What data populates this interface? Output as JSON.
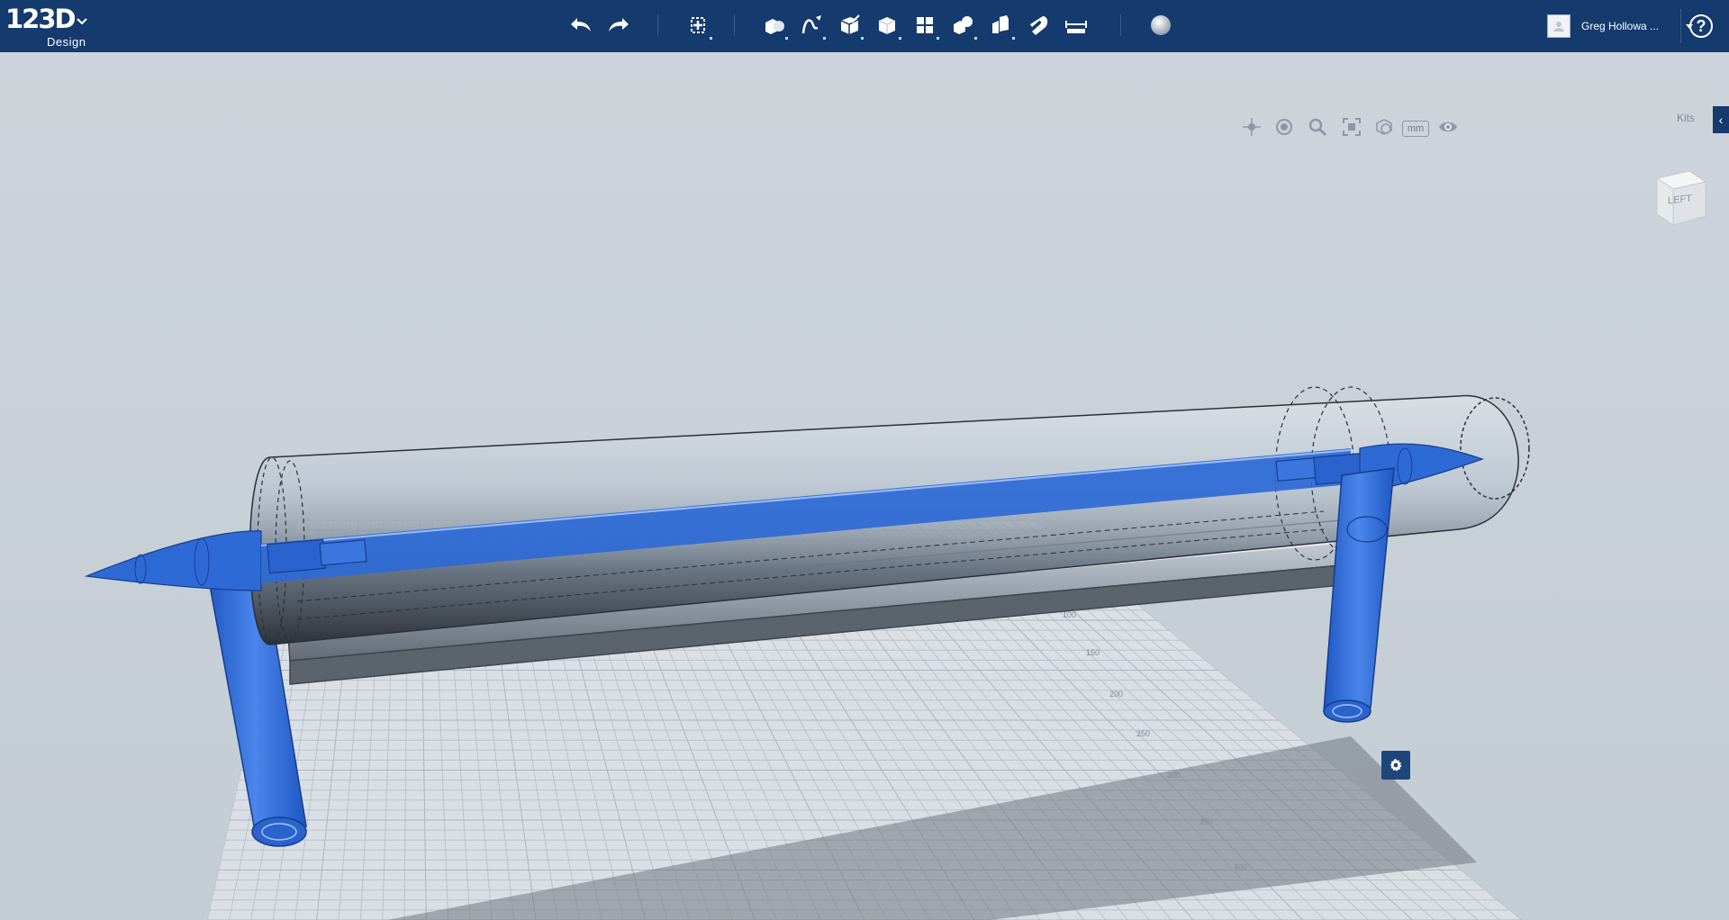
{
  "app": {
    "logo_number": "123D",
    "logo_word": "Design"
  },
  "toolbar": {
    "items": [
      {
        "name": "undo-icon"
      },
      {
        "name": "redo-icon"
      },
      {
        "name": "transform-icon"
      },
      {
        "name": "primitives-icon"
      },
      {
        "name": "sketch-icon"
      },
      {
        "name": "construct-icon"
      },
      {
        "name": "modify-icon"
      },
      {
        "name": "pattern-icon"
      },
      {
        "name": "grouping-icon"
      },
      {
        "name": "combine-icon"
      },
      {
        "name": "snap-icon"
      },
      {
        "name": "measure-icon"
      },
      {
        "name": "material-icon"
      }
    ]
  },
  "user": {
    "name": "Greg Hollowa ..."
  },
  "help": {
    "label": "?"
  },
  "nav": {
    "units_label": "mm"
  },
  "kits": {
    "label": "Kits",
    "toggle": "‹"
  },
  "viewcube": {
    "face_label": "LEFT"
  },
  "colors": {
    "topbar": "#143a6e",
    "accent_blue": "#2d6ad6",
    "viewport_bg": "#c9d1d9",
    "grid_line": "#b9c3cd"
  }
}
